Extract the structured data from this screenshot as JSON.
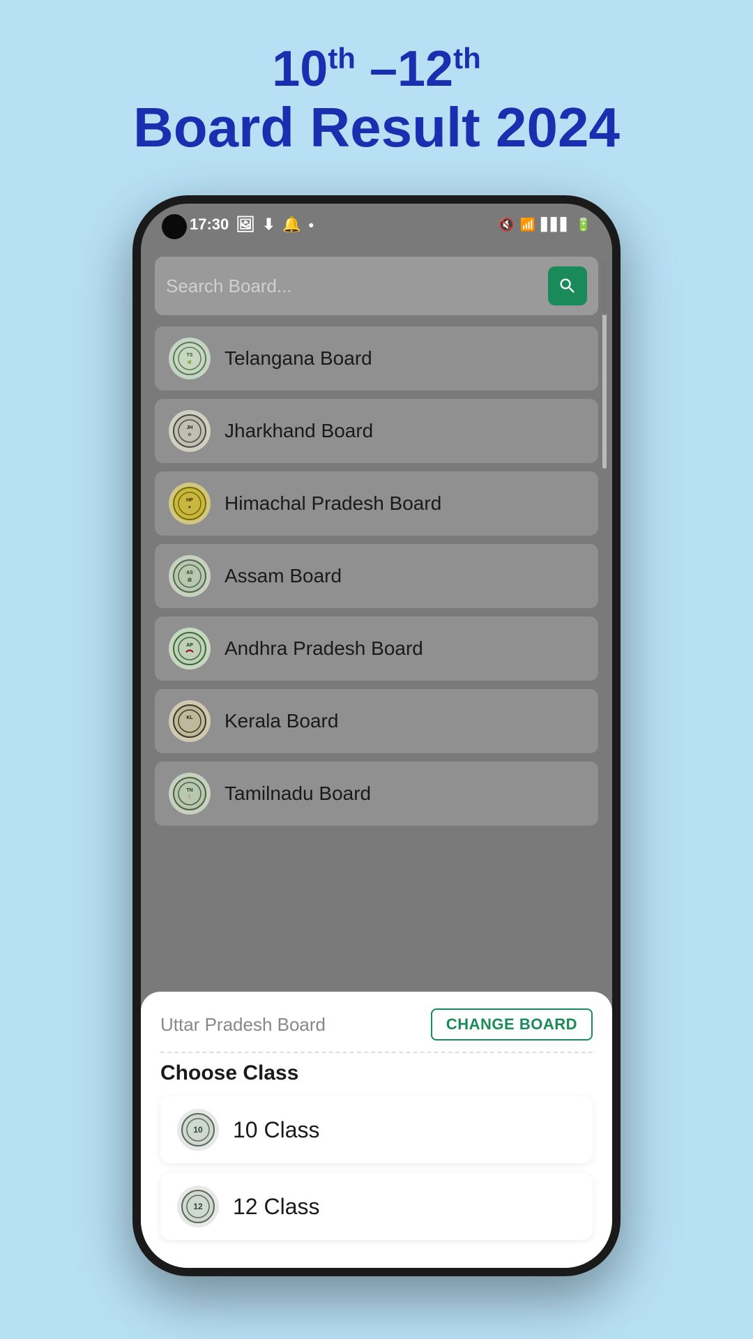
{
  "header": {
    "title_line1": "10th –12th",
    "title_line2": "Board Result 2024"
  },
  "status_bar": {
    "time": "17:30",
    "icons_left": [
      "gallery-icon",
      "download-icon",
      "bell-icon",
      "dot-icon"
    ],
    "icons_right": [
      "mute-icon",
      "wifi-icon",
      "signal-icon",
      "battery-icon"
    ]
  },
  "search": {
    "placeholder": "Search Board..."
  },
  "search_button_label": "🔍",
  "boards": [
    {
      "name": "Telangana Board",
      "icon": "telangana-seal"
    },
    {
      "name": "Jharkhand Board",
      "icon": "jharkhand-seal"
    },
    {
      "name": "Himachal Pradesh Board",
      "icon": "himachal-seal"
    },
    {
      "name": "Assam Board",
      "icon": "assam-seal"
    },
    {
      "name": "Andhra Pradesh Board",
      "icon": "andhra-seal"
    },
    {
      "name": "Kerala Board",
      "icon": "kerala-seal"
    },
    {
      "name": "Tamilnadu Board",
      "icon": "tamilnadu-seal"
    }
  ],
  "bottom_sheet": {
    "selected_board": "Uttar Pradesh Board",
    "change_board_label": "CHANGE BOARD",
    "choose_class_label": "Choose Class",
    "classes": [
      {
        "name": "10 Class",
        "icon": "class10-seal"
      },
      {
        "name": "12 Class",
        "icon": "class12-seal"
      }
    ]
  }
}
